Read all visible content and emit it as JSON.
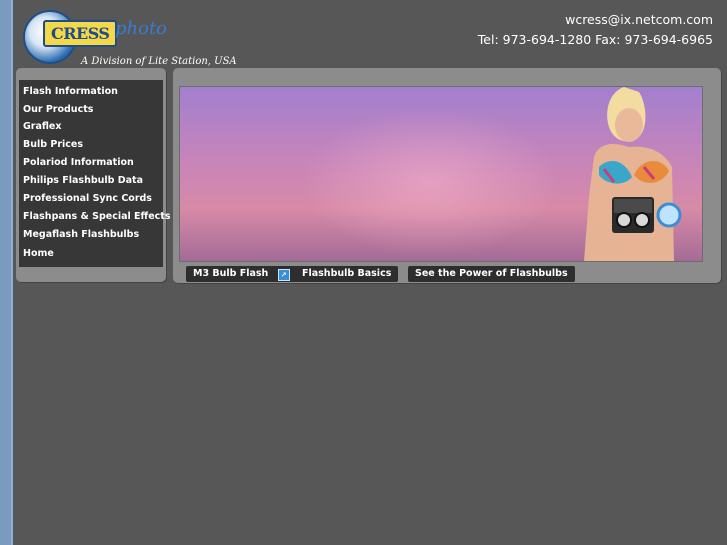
{
  "header": {
    "brand_word": "CRESS",
    "brand_photo": "photo",
    "brand_sub": "A Division of Lite Station, USA",
    "email": "wcress@ix.netcom.com",
    "phone_line": "Tel: 973-694-1280 Fax: 973-694-6965"
  },
  "sidebar": {
    "items": [
      {
        "label": "Flash Information"
      },
      {
        "label": "Our Products"
      },
      {
        "label": "Graflex"
      },
      {
        "label": "Bulb Prices"
      },
      {
        "label": "Polariod Information"
      },
      {
        "label": "Philips Flashbulb Data"
      },
      {
        "label": "Professional Sync Cords"
      },
      {
        "label": "Flashpans & Special Effects"
      },
      {
        "label": "Megaflash Flashbulbs"
      },
      {
        "label": "Home"
      }
    ]
  },
  "tabs": [
    {
      "label": "M3 Bulb Flash",
      "icon": "external-link-icon"
    },
    {
      "label": "Flashbulb Basics"
    },
    {
      "label": "See the Power of Flashbulbs"
    }
  ],
  "colors": {
    "page_bg": "#575757",
    "frame_bg": "#7a9bbf",
    "panel_bg": "#8c8c8c",
    "nav_bg": "#373737",
    "tab_bg": "#2e2e2e"
  }
}
